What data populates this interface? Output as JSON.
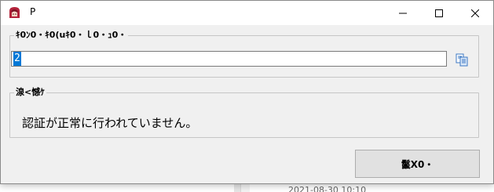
{
  "window": {
    "title": "P"
  },
  "token_group": {
    "legend": "ｷ0ﾝ0・ｷ0(uｷ0・ｌ0・ｭ0・",
    "input_value": "2"
  },
  "status_group": {
    "legend": "湶<憾ｹ",
    "message": "認証が正常に行われていません。"
  },
  "ok_button": {
    "label": "鬣X0・"
  },
  "background": {
    "row_text_left": "",
    "row_text_right": "2021-08-30 10:10"
  },
  "colors": {
    "selection": "#0078d7",
    "dialog_bg": "#f0f0f0",
    "titlebar_bg": "#ffffff",
    "button_bg": "#e1e1e1"
  },
  "icons": {
    "app": "app-icon",
    "minimize": "minimize-icon",
    "maximize": "maximize-icon",
    "close": "close-icon",
    "copy": "copy-icon"
  }
}
